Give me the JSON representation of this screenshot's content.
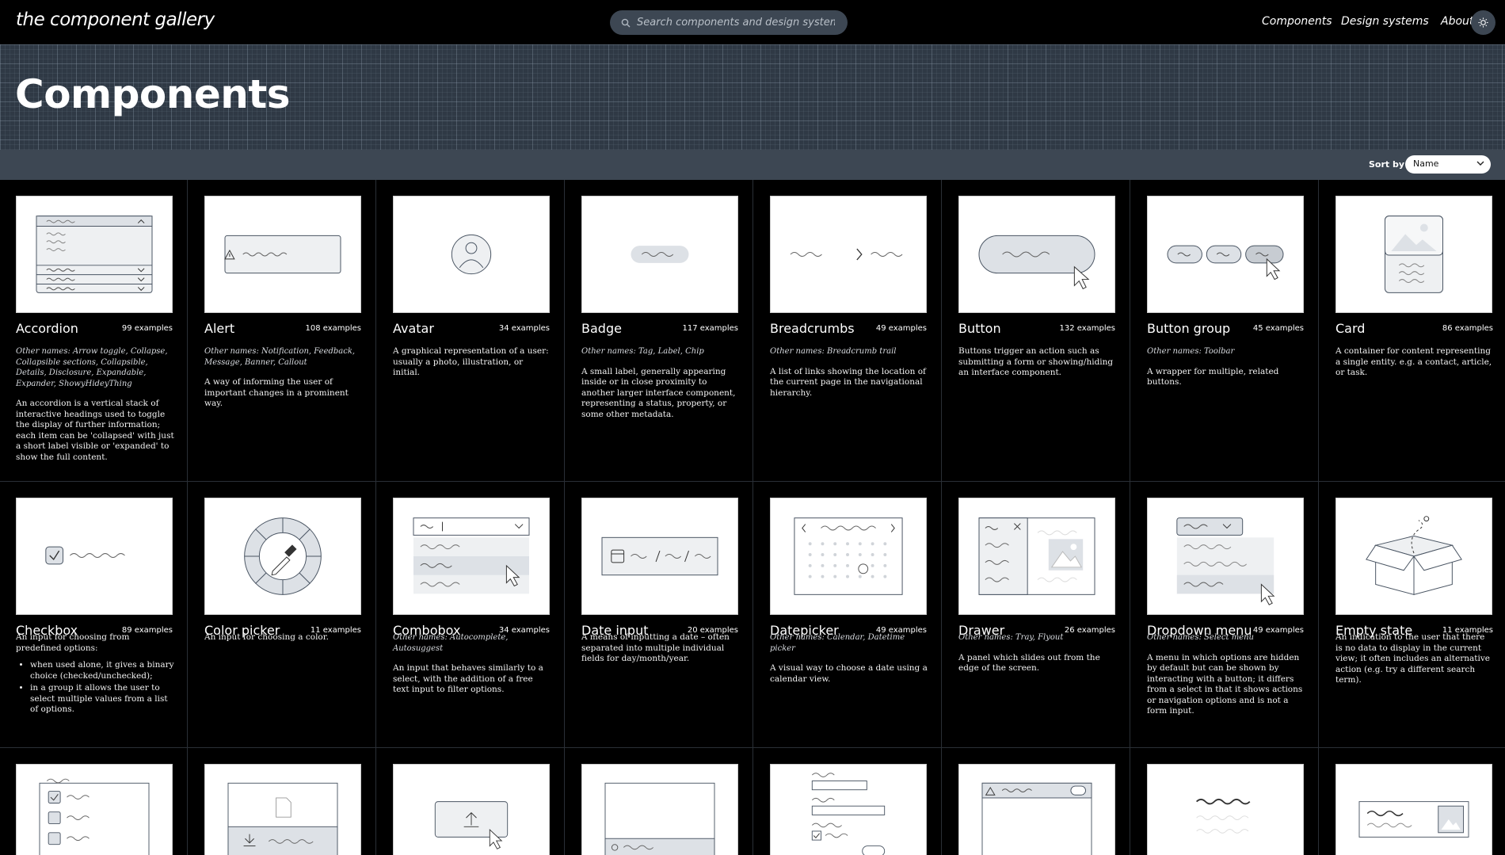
{
  "header": {
    "logo": "the component gallery",
    "search_placeholder": "Search components and design systems",
    "nav": [
      "Components",
      "Design systems",
      "About"
    ],
    "theme_icon": "sun-icon"
  },
  "hero": {
    "title": "Components"
  },
  "sort": {
    "label": "Sort by",
    "value": "Name"
  },
  "cards": [
    {
      "name": "Accordion",
      "count": "99 examples",
      "other": "Other names: Arrow toggle, Collapse, Collapsible sections, Collapsible, Details, Disclosure, Expandable, Expander, ShowyHideyThing",
      "desc": "An accordion is a vertical stack of interactive headings used to toggle the display of further information; each item can be 'collapsed' with just a short label visible or 'expanded' to show the full content."
    },
    {
      "name": "Alert",
      "count": "108 examples",
      "other": "Other names: Notification, Feedback, Message, Banner, Callout",
      "desc": "A way of informing the user of important changes in a prominent way."
    },
    {
      "name": "Avatar",
      "count": "34 examples",
      "other": "",
      "desc": "A graphical representation of a user: usually a photo, illustration, or initial."
    },
    {
      "name": "Badge",
      "count": "117 examples",
      "other": "Other names: Tag, Label, Chip",
      "desc": "A small label, generally appearing inside or in close proximity to another larger interface component, representing a status, property, or some other metadata."
    },
    {
      "name": "Breadcrumbs",
      "count": "49 examples",
      "other": "Other names: Breadcrumb trail",
      "desc": "A list of links showing the location of the current page in the navigational hierarchy."
    },
    {
      "name": "Button",
      "count": "132 examples",
      "other": "",
      "desc": "Buttons trigger an action such as submitting a form or showing/hiding an interface component."
    },
    {
      "name": "Button group",
      "count": "45 examples",
      "other": "Other names: Toolbar",
      "desc": "A wrapper for multiple, related buttons."
    },
    {
      "name": "Card",
      "count": "86 examples",
      "other": "",
      "desc": "A container for content representing a single entity. e.g. a contact, article, or task."
    },
    {
      "name": "Checkbox",
      "count": "89 examples",
      "other": "",
      "desc": "An input for choosing from predefined options:",
      "bullets": [
        "when used alone, it gives a binary choice (checked/unchecked);",
        "in a group it allows the user to select multiple values from a list of options."
      ]
    },
    {
      "name": "Color picker",
      "count": "11 examples",
      "other": "",
      "desc": "An input for choosing a color."
    },
    {
      "name": "Combobox",
      "count": "34 examples",
      "other": "Other names: Autocomplete, Autosuggest",
      "desc": "An input that behaves similarly to a select, with the addition of a free text input to filter options."
    },
    {
      "name": "Date input",
      "count": "20 examples",
      "other": "",
      "desc": "A means of inputting a date – often separated into multiple individual fields for day/month/year."
    },
    {
      "name": "Datepicker",
      "count": "49 examples",
      "other": "Other names: Calendar, Datetime picker",
      "desc": "A visual way to choose a date using a calendar view."
    },
    {
      "name": "Drawer",
      "count": "26 examples",
      "other": "Other names: Tray, Flyout",
      "desc": "A panel which slides out from the edge of the screen."
    },
    {
      "name": "Dropdown menu",
      "count": "49 examples",
      "other": "Other names: Select menu",
      "desc": "A menu in which options are hidden by default but can be shown by interacting with a button; it differs from a select in that it shows actions or navigation options and is not a form input."
    },
    {
      "name": "Empty state",
      "count": "11 examples",
      "other": "",
      "desc": "An indication to the user that there is no data to display in the current view; it often includes an alternative action (e.g. try a different search term)."
    }
  ],
  "colors": {
    "background": "#000000",
    "hero": "#2f3945",
    "sortbar": "#3d4753",
    "illustration_fill": "#dde1e6",
    "illustration_stroke": "#4a5563"
  }
}
